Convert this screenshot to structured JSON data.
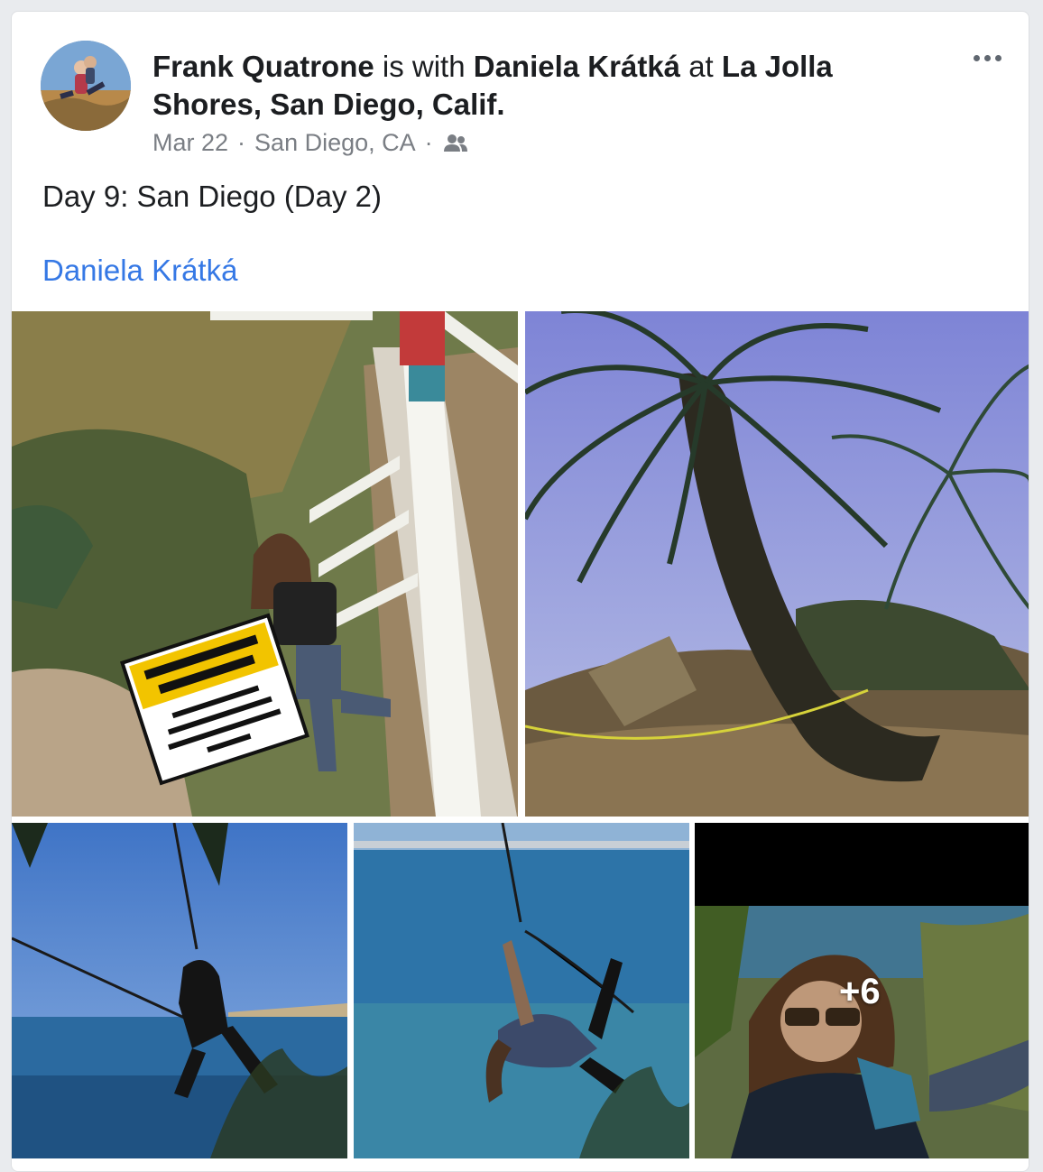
{
  "post": {
    "author": "Frank Quatrone",
    "with_text": "is with",
    "tagged_person": "Daniela Krátká",
    "at_text": "at",
    "location": "La Jolla Shores, San Diego, Calif.",
    "date": "Mar 22",
    "place": "San Diego, CA",
    "audience_icon": "friends-icon",
    "message": "Day 9: San Diego (Day 2)",
    "tag_link": "Daniela Krátká",
    "more_photos_count": "+6"
  },
  "colors": {
    "link": "#3578e5",
    "text": "#1c1e21",
    "meta": "#7a7e84"
  }
}
